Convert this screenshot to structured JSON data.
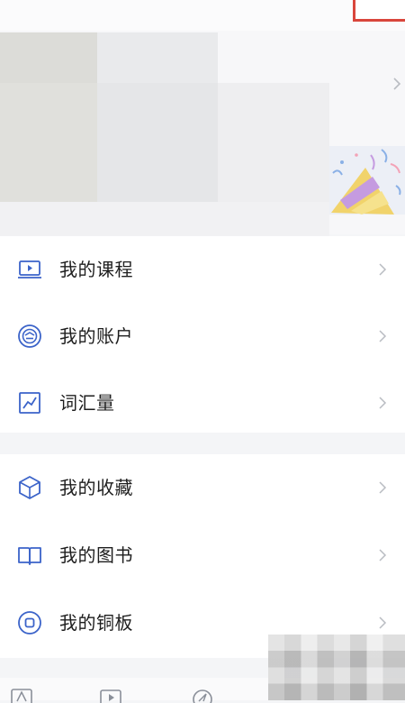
{
  "menu_group_1": [
    {
      "label": "我的课程",
      "icon": "course-icon"
    },
    {
      "label": "我的账户",
      "icon": "account-icon"
    },
    {
      "label": "词汇量",
      "icon": "vocabulary-icon"
    }
  ],
  "menu_group_2": [
    {
      "label": "我的收藏",
      "icon": "favorites-icon"
    },
    {
      "label": "我的图书",
      "icon": "book-icon"
    },
    {
      "label": "我的铜板",
      "icon": "coins-icon"
    }
  ],
  "colors": {
    "icon_blue": "#3b63c9",
    "chevron": "#b9bcc2",
    "highlight_box": "#d9463c"
  },
  "bottom_nav_icons": [
    "text-icon",
    "play-icon",
    "compass-icon"
  ]
}
